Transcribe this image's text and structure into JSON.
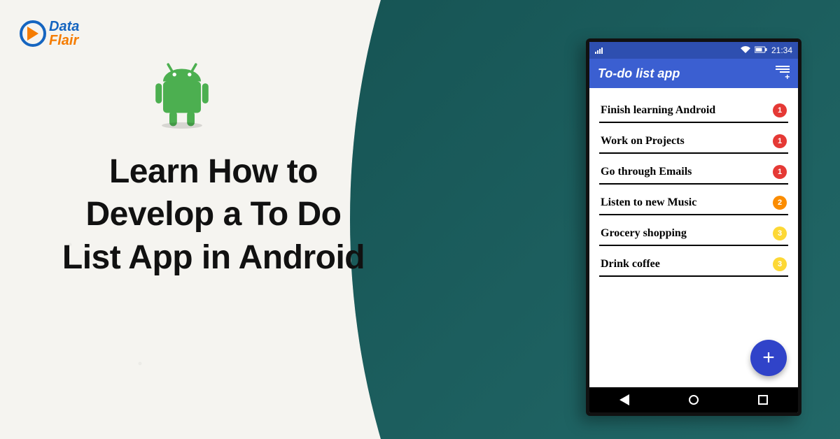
{
  "logo": {
    "line1": "Data",
    "line2": "Flair"
  },
  "headline": "Learn How to Develop a To Do List App in Android",
  "phone": {
    "status": {
      "time": "21:34"
    },
    "app_bar": {
      "title": "To-do list app"
    },
    "todos": [
      {
        "label": "Finish learning Android",
        "priority": 1
      },
      {
        "label": "Work on Projects",
        "priority": 1
      },
      {
        "label": "Go through Emails",
        "priority": 1
      },
      {
        "label": "Listen to new Music",
        "priority": 2
      },
      {
        "label": "Grocery shopping",
        "priority": 3
      },
      {
        "label": "Drink coffee",
        "priority": 3
      }
    ],
    "fab_label": "+"
  }
}
